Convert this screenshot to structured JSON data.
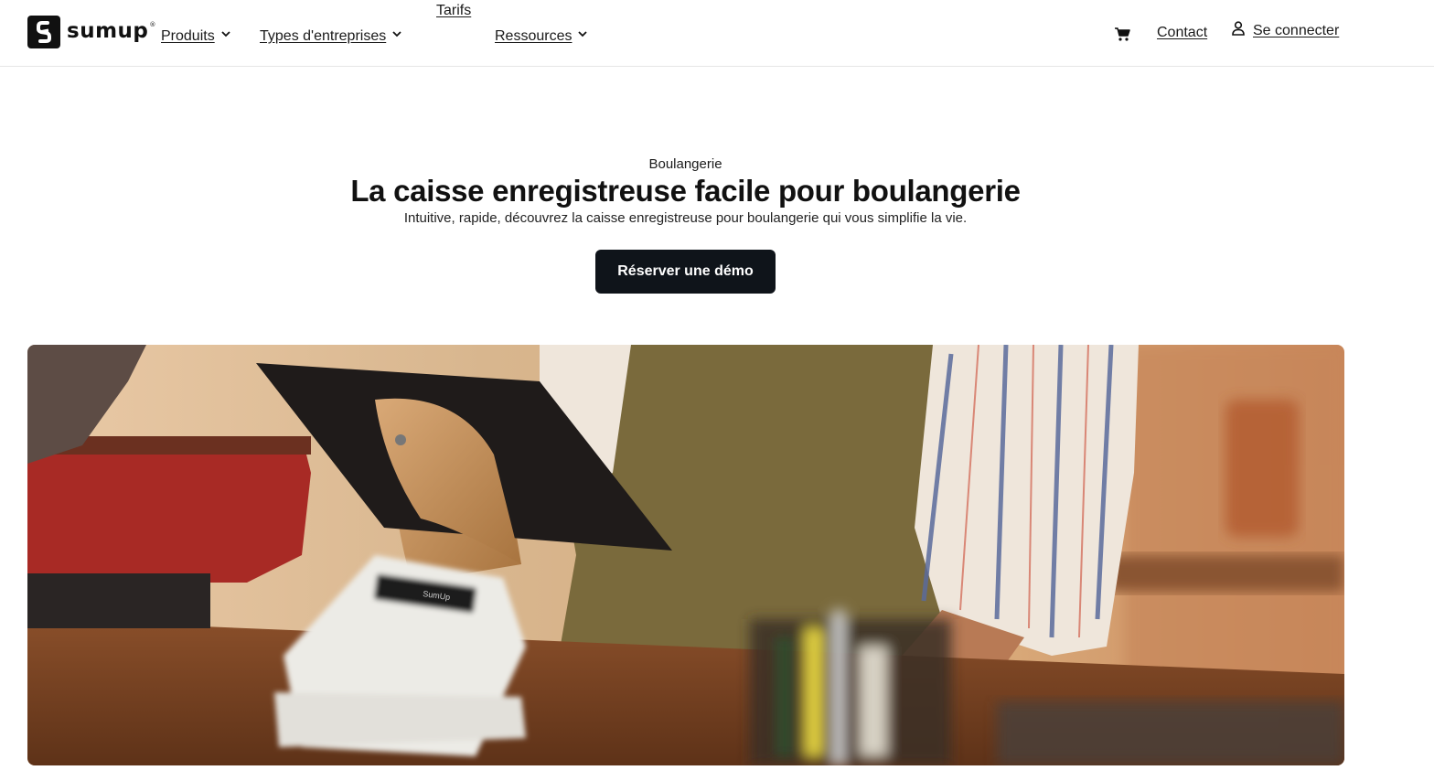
{
  "brand": {
    "name": "sumup",
    "registered_mark": "®"
  },
  "nav": {
    "items": [
      {
        "label": "Produits",
        "has_dropdown": true
      },
      {
        "label": "Types d'entreprises",
        "has_dropdown": true
      },
      {
        "label": "Tarifs",
        "has_dropdown": false
      },
      {
        "label": "Ressources",
        "has_dropdown": true
      }
    ],
    "cart_icon": "cart-icon",
    "contact_label": "Contact",
    "login_label": "Se connecter",
    "login_icon": "user-icon"
  },
  "hero": {
    "eyebrow": "Boulangerie",
    "title": "La caisse enregistreuse facile pour boulangerie",
    "subtitle": "Intuitive, rapide, découvrez la caisse enregistreuse pour boulangerie qui vous simplifie la vie.",
    "cta_label": "Réserver une démo",
    "image_screen_text": "SumUp"
  },
  "colors": {
    "cta_background": "#0f141a",
    "text": "#111111",
    "divider": "#e6e6e6"
  }
}
